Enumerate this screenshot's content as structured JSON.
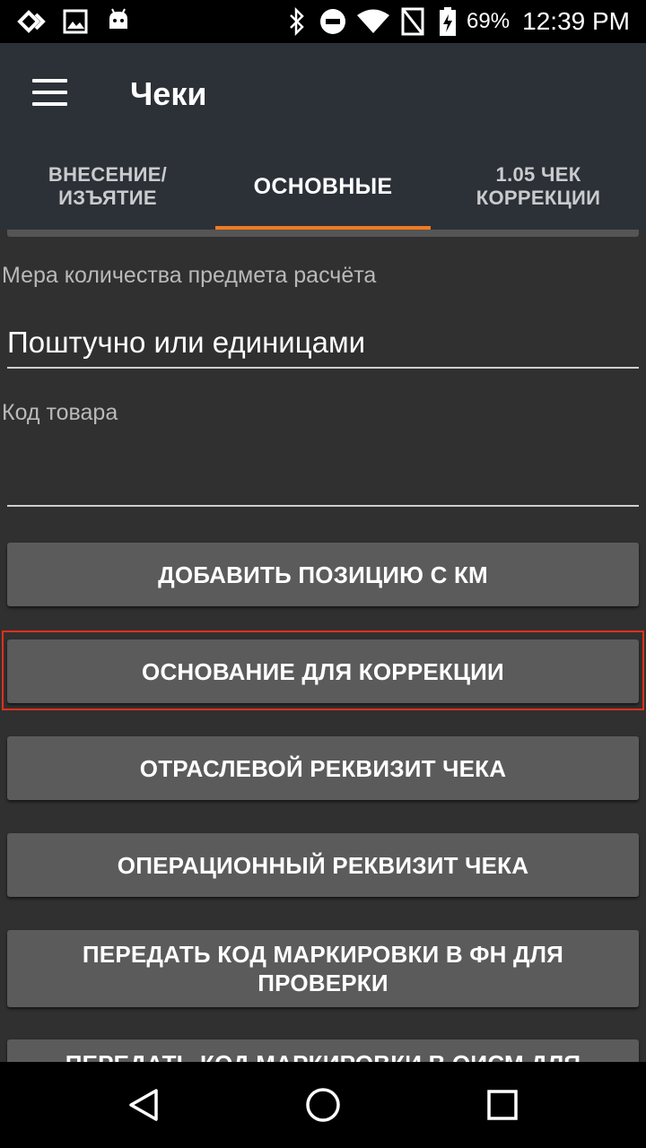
{
  "status_bar": {
    "battery": "69%",
    "time": "12:39 PM",
    "icons": [
      "diamond-icon",
      "image-icon",
      "android-icon",
      "bluetooth-icon",
      "do-not-disturb-icon",
      "wifi-icon",
      "no-sim-icon",
      "battery-charging-icon"
    ]
  },
  "app_bar": {
    "title": "Чеки",
    "tabs": [
      {
        "label": "ВНЕСЕНИЕ/\nИЗЪЯТИЕ",
        "active": false
      },
      {
        "label": "ОСНОВНЫЕ",
        "active": true
      },
      {
        "label": "1.05 ЧЕК\nКОРРЕКЦИИ",
        "active": false
      }
    ],
    "accent_color": "#f07b22"
  },
  "form": {
    "quantity_measure": {
      "label": "Мера количества предмета расчёта",
      "value": "Поштучно или единицами"
    },
    "product_code": {
      "label": "Код товара",
      "value": ""
    }
  },
  "buttons": {
    "add_position_km": "ДОБАВИТЬ ПОЗИЦИЮ С КМ",
    "correction_basis": "ОСНОВАНИЕ ДЛЯ КОРРЕКЦИИ",
    "industry_requisite": "ОТРАСЛЕВОЙ РЕКВИЗИТ ЧЕКА",
    "operational_requisite": "ОПЕРАЦИОННЫЙ РЕКВИЗИТ ЧЕКА",
    "send_code_fn": "ПЕРЕДАТЬ КОД МАРКИРОВКИ В ФН ДЛЯ ПРОВЕРКИ",
    "send_code_oism": "ПЕРЕДАТЬ КОД МАРКИРОВКИ В ОИСМ ДЛЯ"
  },
  "highlight_color": "#e2301c"
}
